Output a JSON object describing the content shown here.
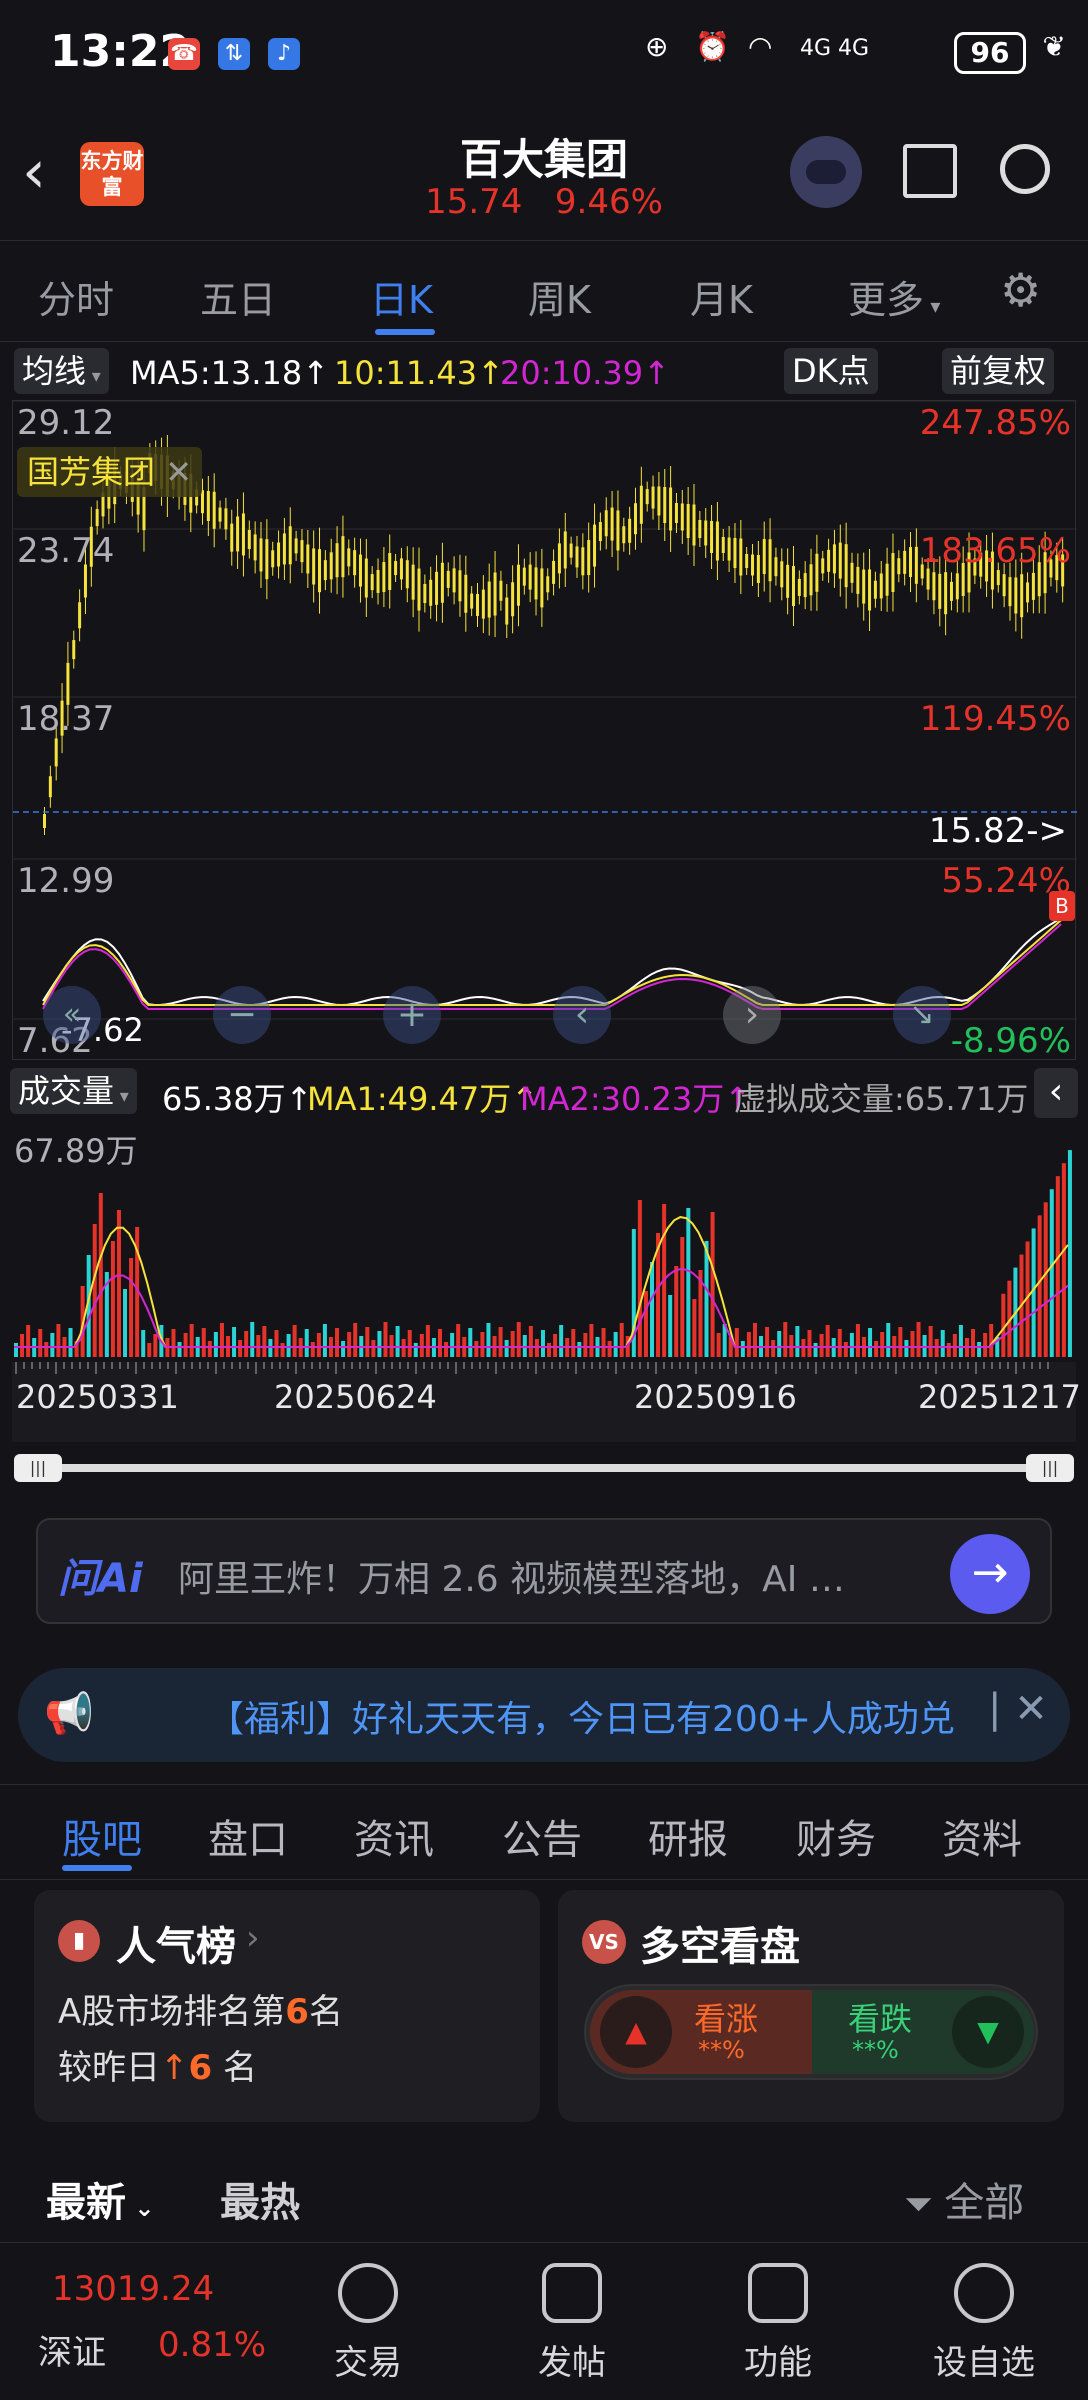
{
  "status_bar": {
    "time": "13:22",
    "network": "4G 4G",
    "battery": "96"
  },
  "header": {
    "logo_text": "东方财富",
    "stock_name": "百大集团",
    "price": "15.74",
    "change_pct": "9.46%"
  },
  "tabs": [
    "分时",
    "五日",
    "日K",
    "周K",
    "月K",
    "更多"
  ],
  "ma_line": {
    "label": "均线",
    "ma5": "MA5:13.18↑",
    "ma10": "10:11.43↑",
    "ma20": "20:10.39↑",
    "dk_button": "DK点",
    "adjust_button": "前复权"
  },
  "kchart": {
    "y_labels": [
      "29.12",
      "23.74",
      "18.37",
      "12.99",
      "7.62"
    ],
    "pct_labels": [
      "247.85%",
      "183.65%",
      "119.45%",
      "55.24%",
      "-8.96%"
    ],
    "tag_label": "国芳集团",
    "tag_close": "✕",
    "current_marker": "15.82->",
    "low_marker": "-7.62",
    "badge": "B"
  },
  "volume_line": {
    "label": "成交量",
    "value": "65.38万↑",
    "ma1": "MA1:49.47万↑",
    "ma2": "MA2:30.23万↑",
    "virtual": "虚拟成交量:65.71万"
  },
  "volume_chart": {
    "max_label": "67.89万"
  },
  "dates": [
    "20250331",
    "20250624",
    "20250916",
    "20251217"
  ],
  "ai_bar": {
    "brand": "问Ai",
    "text": "阿里王炸！万相 2.6 视频模型落地，AI …"
  },
  "notice": {
    "text": "【福利】好礼天天有，今日已有200+人成功兑"
  },
  "bottom_tabs": [
    "股吧",
    "盘口",
    "资讯",
    "公告",
    "研报",
    "财务",
    "资料"
  ],
  "popularity_card": {
    "title": "人气榜",
    "line1_prefix": "A股市场排名第",
    "line1_rank": "6",
    "line1_suffix": "名",
    "line2_prefix": "较昨日",
    "line2_arrow": "↑",
    "line2_num": "6",
    "line2_suffix": " 名"
  },
  "sentiment_card": {
    "title": "多空看盘",
    "bull_label": "看涨",
    "bull_value": "**%",
    "bear_label": "看跌",
    "bear_value": "**%"
  },
  "filter_bar": {
    "latest": "最新",
    "hottest": "最热",
    "all": "全部"
  },
  "bottom_nav": {
    "index_value": "13019.24",
    "index_name": "深证",
    "index_change": "0.81%",
    "items": [
      "交易",
      "发帖",
      "功能",
      "设自选"
    ]
  },
  "colors": {
    "up": "#e6332a",
    "down": "#22c05a",
    "accent": "#3f7ff0",
    "ma5": "#ffffff",
    "ma10": "#f5e23a",
    "ma20": "#d326d3"
  }
}
